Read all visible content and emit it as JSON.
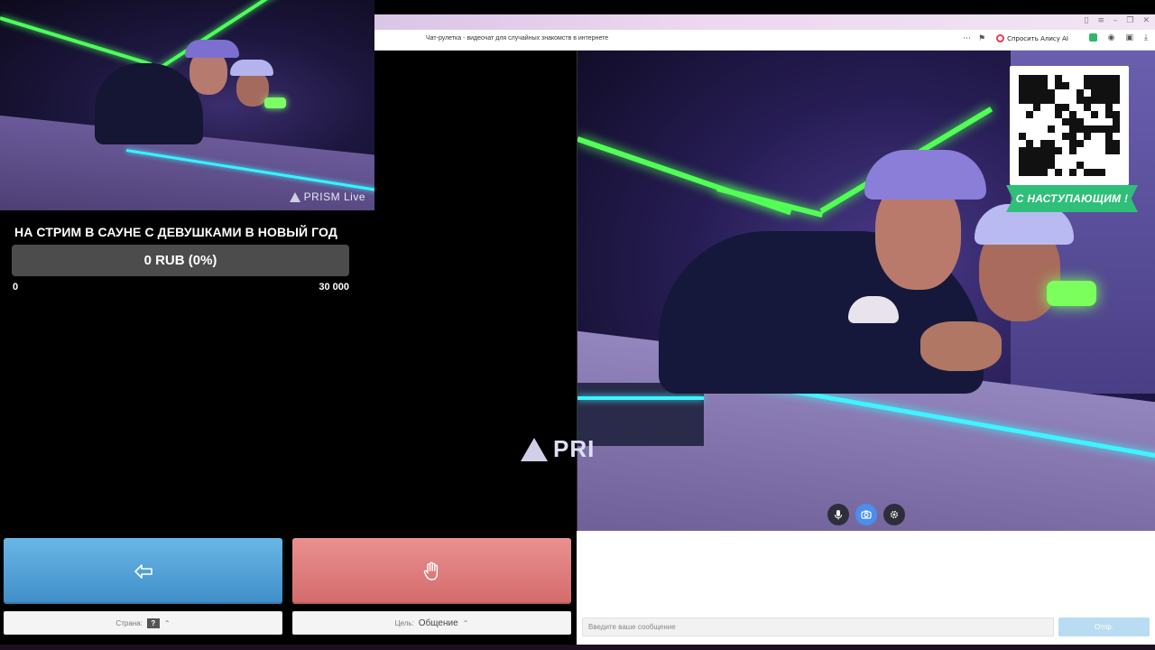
{
  "browser": {
    "page_title": "Чат-рулетка - видеочат для случайных знакомств в интернете",
    "alice_label": "Спросить Алису AI"
  },
  "stream": {
    "brand_small": "PRISM Live",
    "brand_big": "PRI"
  },
  "goal": {
    "title": "НА СТРИМ В САУНЕ С ДЕВУШКАМИ В НОВЫЙ ГОД",
    "amount_label": "0 RUB (0%)",
    "progress": 0,
    "min": "0",
    "max": "30 000"
  },
  "overlay": {
    "banner": "С НАСТУПАЮЩИМ !"
  },
  "controls": {
    "country_label": "Страна:",
    "country_value": "?",
    "goal_label": "Цель:",
    "goal_value": "Общение"
  },
  "chat": {
    "placeholder": "Введите ваше сообщение",
    "send_label": "Отпр."
  },
  "colors": {
    "next_button": "#4f9fd6",
    "stop_button": "#e07a7a",
    "banner": "#2fbf79"
  },
  "icons": {
    "next": "arrow-left-icon",
    "stop": "hand-icon",
    "mic": "microphone-icon",
    "camera": "camera-icon",
    "settings": "gear-icon"
  }
}
